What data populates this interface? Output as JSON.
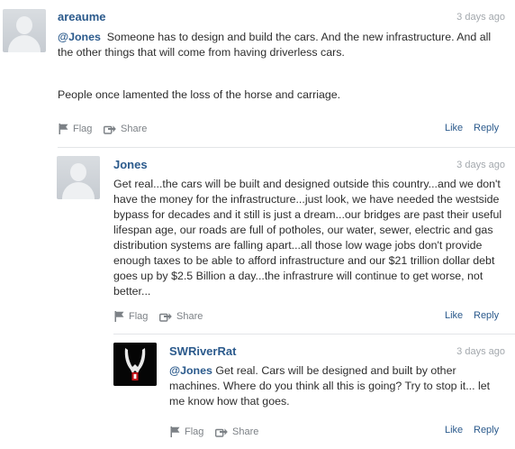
{
  "comments": [
    {
      "author": "areaume",
      "time": "3 days ago",
      "mention": "@Jones",
      "text": "Someone has to design and build the cars. And the new infrastructure. And all the other things that will come from having driverless cars.",
      "text2": "People once lamented the loss of the horse and carriage.",
      "flag": "Flag",
      "share": "Share",
      "like": "Like",
      "reply": "Reply"
    },
    {
      "author": "Jones",
      "time": "3 days ago",
      "text": "Get real...the cars will be built and designed outside this country...and we don't have the money for the infrastructure...just look, we have needed the westside bypass for decades and it still is just a dream...our bridges are past their useful lifespan age, our roads are full of potholes, our water, sewer, electric and gas distribution systems are falling apart...all those low wage jobs don't provide enough taxes to be able to afford infrastructure and our $21 trillion dollar debt goes up by $2.5 Billion a day...the infrastrure will continue to get worse, not better...",
      "flag": "Flag",
      "share": "Share",
      "like": "Like",
      "reply": "Reply"
    },
    {
      "author": "SWRiverRat",
      "time": "3 days ago",
      "mention": "@Jones",
      "text": "Get real. Cars will be designed and built by other machines. Where do you think all this is going? Try to stop it... let me know how that goes.",
      "flag": "Flag",
      "share": "Share",
      "like": "Like",
      "reply": "Reply"
    }
  ],
  "colors": {
    "author": "#2b5a8c",
    "muted": "#a3a8ad",
    "action": "#7c8186",
    "divider": "#e3e5e8"
  },
  "icons": [
    "avatar-placeholder-icon",
    "flag-icon",
    "share-icon"
  ]
}
